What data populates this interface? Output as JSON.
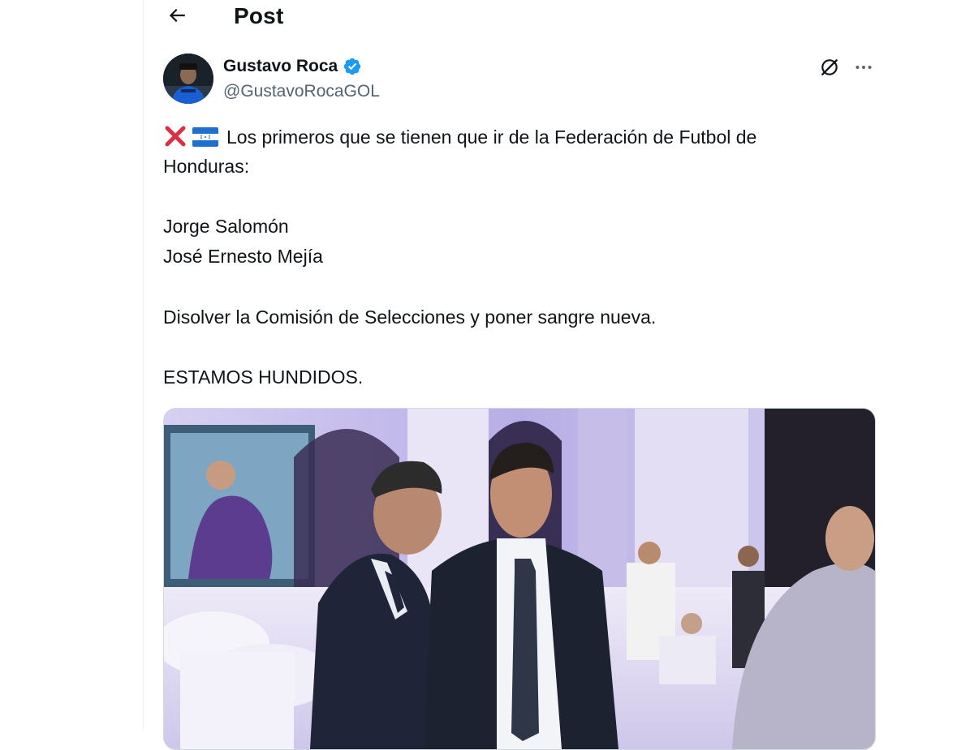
{
  "header": {
    "title": "Post"
  },
  "tweet": {
    "author": {
      "name": "Gustavo Roca",
      "handle": "@GustavoRocaGOL",
      "verified": true
    },
    "icons": {
      "back": "arrow-left-icon",
      "grok": "grok-icon",
      "more": "more-icon",
      "verified": "verified-badge-icon",
      "emoji_1": "cross-mark-emoji",
      "emoji_2": "honduras-flag-emoji"
    },
    "text": {
      "line1": "Los primeros que se tienen que ir de la Federación de Futbol de",
      "line2": "Honduras:",
      "line3": "Jorge Salomón",
      "line4": "José Ernesto Mejía",
      "line5": "Disolver la Comisión de Selecciones y poner sangre nueva.",
      "line6": "ESTAMOS HUNDIDOS."
    },
    "media": {
      "description": "photo"
    }
  },
  "colors": {
    "text": "#0f1419",
    "secondary": "#536471",
    "verified": "#1d9bf0",
    "border": "#cfd9de"
  }
}
